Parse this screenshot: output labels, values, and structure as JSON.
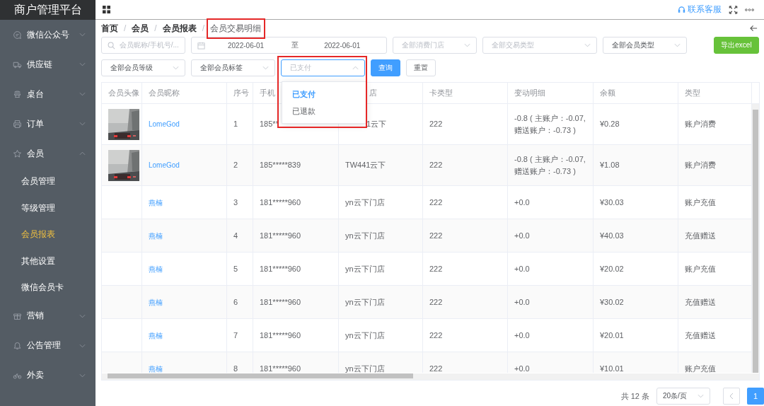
{
  "app_title": "商户管理平台",
  "sidebar": {
    "items": [
      {
        "label": "微信公众号",
        "expanded": false
      },
      {
        "label": "供应链",
        "expanded": false
      },
      {
        "label": "桌台",
        "expanded": false
      },
      {
        "label": "订单",
        "expanded": false
      },
      {
        "label": "会员",
        "expanded": true,
        "children": [
          {
            "label": "会员管理",
            "selected": false
          },
          {
            "label": "等级管理",
            "selected": false
          },
          {
            "label": "会员报表",
            "selected": true
          },
          {
            "label": "其他设置",
            "selected": false
          },
          {
            "label": "微信会员卡",
            "selected": false
          }
        ]
      },
      {
        "label": "营销",
        "expanded": false
      },
      {
        "label": "公告管理",
        "expanded": false
      },
      {
        "label": "外卖",
        "expanded": false
      }
    ]
  },
  "topbar": {
    "support_link": "联系客服"
  },
  "breadcrumb": [
    {
      "label": "首页"
    },
    {
      "separator": "/",
      "label": "会员"
    },
    {
      "separator": "/",
      "label": "会员报表"
    },
    {
      "separator": "/",
      "label": "会员交易明细"
    }
  ],
  "filters": {
    "search": {
      "placeholder": "会员昵称/手机号/..."
    },
    "date_range": {
      "start": "2022-06-01",
      "separator": "至",
      "end": "2022-06-01"
    },
    "row1_selects": [
      {
        "placeholder": "全部消费门店"
      },
      {
        "placeholder": "全部交易类型"
      },
      {
        "value": "全部会员类型"
      }
    ],
    "export_button": "导出excel",
    "row2_selects": [
      {
        "value": "全部会员等级"
      },
      {
        "value": "全部会员标签"
      }
    ],
    "status_select": {
      "placeholder": "已支付",
      "expanded": true,
      "options": [
        {
          "label": "已支付",
          "selected": true
        },
        {
          "label": "已退款",
          "selected": false
        }
      ]
    },
    "query_button": "查询",
    "reset_button": "重置"
  },
  "table": {
    "columns": [
      "会员头像",
      "会员昵称",
      "序号",
      "手机",
      "店",
      "卡类型",
      "变动明细",
      "余额",
      "类型"
    ],
    "rows": [
      {
        "avatar": true,
        "nickname": "LomeGod",
        "seq": "1",
        "phone": "185**",
        "store": "1云下",
        "card": "222",
        "change": [
          "-0.8 ( 主账户：-0.07,",
          "赠送账户：-0.73 )"
        ],
        "balance": "¥0.28",
        "type": "账户消费"
      },
      {
        "avatar": true,
        "nickname": "LomeGod",
        "seq": "2",
        "phone": "185*****839",
        "store": "TW441云下",
        "card": "222",
        "change": [
          "-0.8 ( 主账户：-0.07,",
          "赠送账户：-0.73 )"
        ],
        "balance": "¥1.08",
        "type": "账户消费"
      },
      {
        "avatar": false,
        "nickname": "燕楠",
        "seq": "3",
        "phone": "181*****960",
        "store": "yn云下门店",
        "card": "222",
        "change": [
          "+0.0"
        ],
        "balance": "¥30.03",
        "type": "账户充值"
      },
      {
        "avatar": false,
        "nickname": "燕楠",
        "seq": "4",
        "phone": "181*****960",
        "store": "yn云下门店",
        "card": "222",
        "change": [
          "+0.0"
        ],
        "balance": "¥40.03",
        "type": "充值赠送"
      },
      {
        "avatar": false,
        "nickname": "燕楠",
        "seq": "5",
        "phone": "181*****960",
        "store": "yn云下门店",
        "card": "222",
        "change": [
          "+0.0"
        ],
        "balance": "¥20.02",
        "type": "账户充值"
      },
      {
        "avatar": false,
        "nickname": "燕楠",
        "seq": "6",
        "phone": "181*****960",
        "store": "yn云下门店",
        "card": "222",
        "change": [
          "+0.0"
        ],
        "balance": "¥30.02",
        "type": "充值赠送"
      },
      {
        "avatar": false,
        "nickname": "燕楠",
        "seq": "7",
        "phone": "181*****960",
        "store": "yn云下门店",
        "card": "222",
        "change": [
          "+0.0"
        ],
        "balance": "¥20.01",
        "type": "充值赠送"
      },
      {
        "avatar": false,
        "nickname": "燕楠",
        "seq": "8",
        "phone": "181*****960",
        "store": "yn云下门店",
        "card": "222",
        "change": [
          "+0.0"
        ],
        "balance": "¥10.01",
        "type": "账户充值"
      }
    ]
  },
  "pagination": {
    "total": "共 12 条",
    "page_size": "20条/页",
    "prev_disabled": true,
    "pages": [
      {
        "label": "1",
        "selected": true
      }
    ]
  }
}
